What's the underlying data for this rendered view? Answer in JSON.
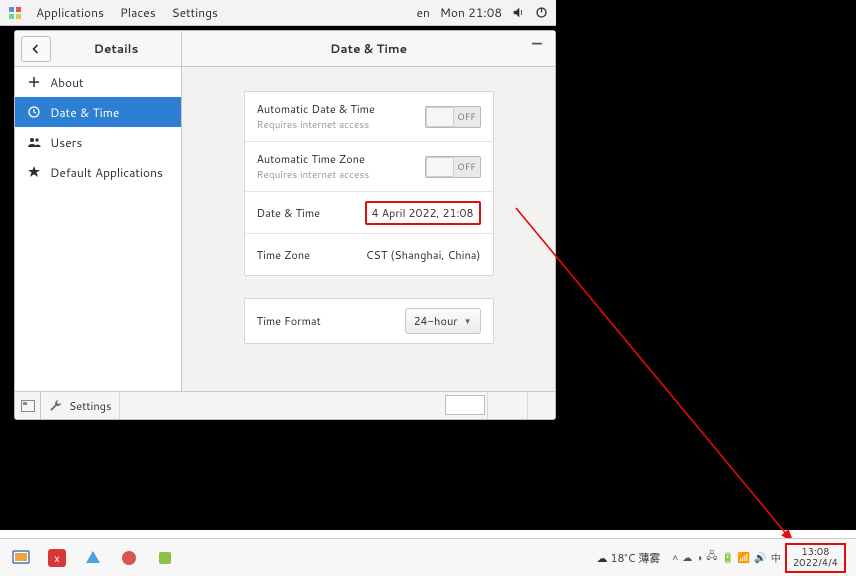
{
  "panel": {
    "menu": {
      "applications": "Applications",
      "places": "Places",
      "settings": "Settings"
    },
    "tray": {
      "lang": "en",
      "clock": "Mon 21:08"
    }
  },
  "window": {
    "left_title": "Details",
    "right_title": "Date & Time",
    "sidebar": {
      "about": "About",
      "datetime": "Date & Time",
      "users": "Users",
      "default_apps": "Default Applications"
    },
    "settings": {
      "auto_dt": {
        "label": "Automatic Date & Time",
        "sub": "Requires internet access",
        "state": "OFF"
      },
      "auto_tz": {
        "label": "Automatic Time Zone",
        "sub": "Requires internet access",
        "state": "OFF"
      },
      "dt": {
        "label": "Date & Time",
        "value": "4 April 2022, 21:08"
      },
      "tz": {
        "label": "Time Zone",
        "value": "CST (Shanghai, China)"
      },
      "fmt": {
        "label": "Time Format",
        "value": "24-hour"
      }
    },
    "footer": {
      "task": "Settings"
    }
  },
  "host": {
    "weather": "18°C  薄雾",
    "clock_time": "13:08",
    "clock_date": "2022/4/4"
  }
}
